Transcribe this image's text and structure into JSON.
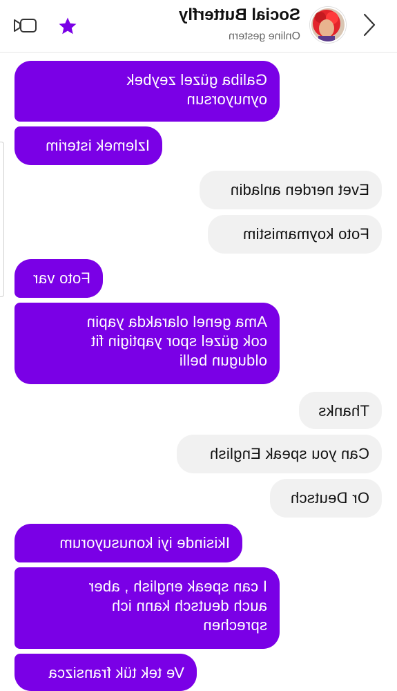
{
  "header": {
    "name": "Social Butterfly",
    "status": "Online gestern",
    "icons": {
      "back": "chevron-left-icon",
      "favorite": "star-icon",
      "call": "video-call-icon"
    },
    "accent_color": "#7a00e6"
  },
  "messages": [
    {
      "direction": "outgoing",
      "text": "Galiba güzel zeybek\noynuyorsun"
    },
    {
      "direction": "outgoing",
      "text": "Izlemek isterim"
    },
    {
      "direction": "incoming",
      "text": "Evet nerden anladin"
    },
    {
      "direction": "incoming",
      "text": "Foto koymamistim"
    },
    {
      "direction": "outgoing",
      "text": "Foto var"
    },
    {
      "direction": "outgoing",
      "text": "Ama genel olarakda yapin\ncok güzel spor yaptigin fit\noldugun belli"
    },
    {
      "direction": "incoming",
      "text": "Thanks"
    },
    {
      "direction": "incoming",
      "text": "Can you speak English"
    },
    {
      "direction": "incoming",
      "text": "Or Deutsch"
    },
    {
      "direction": "outgoing",
      "text": "Ikisinde iyi konusuyorum"
    },
    {
      "direction": "outgoing",
      "text": "I can speak english , aber\nauch deutsch kann ich\nsprechen"
    },
    {
      "direction": "outgoing",
      "text": "Ve tek tük fransizca"
    }
  ]
}
